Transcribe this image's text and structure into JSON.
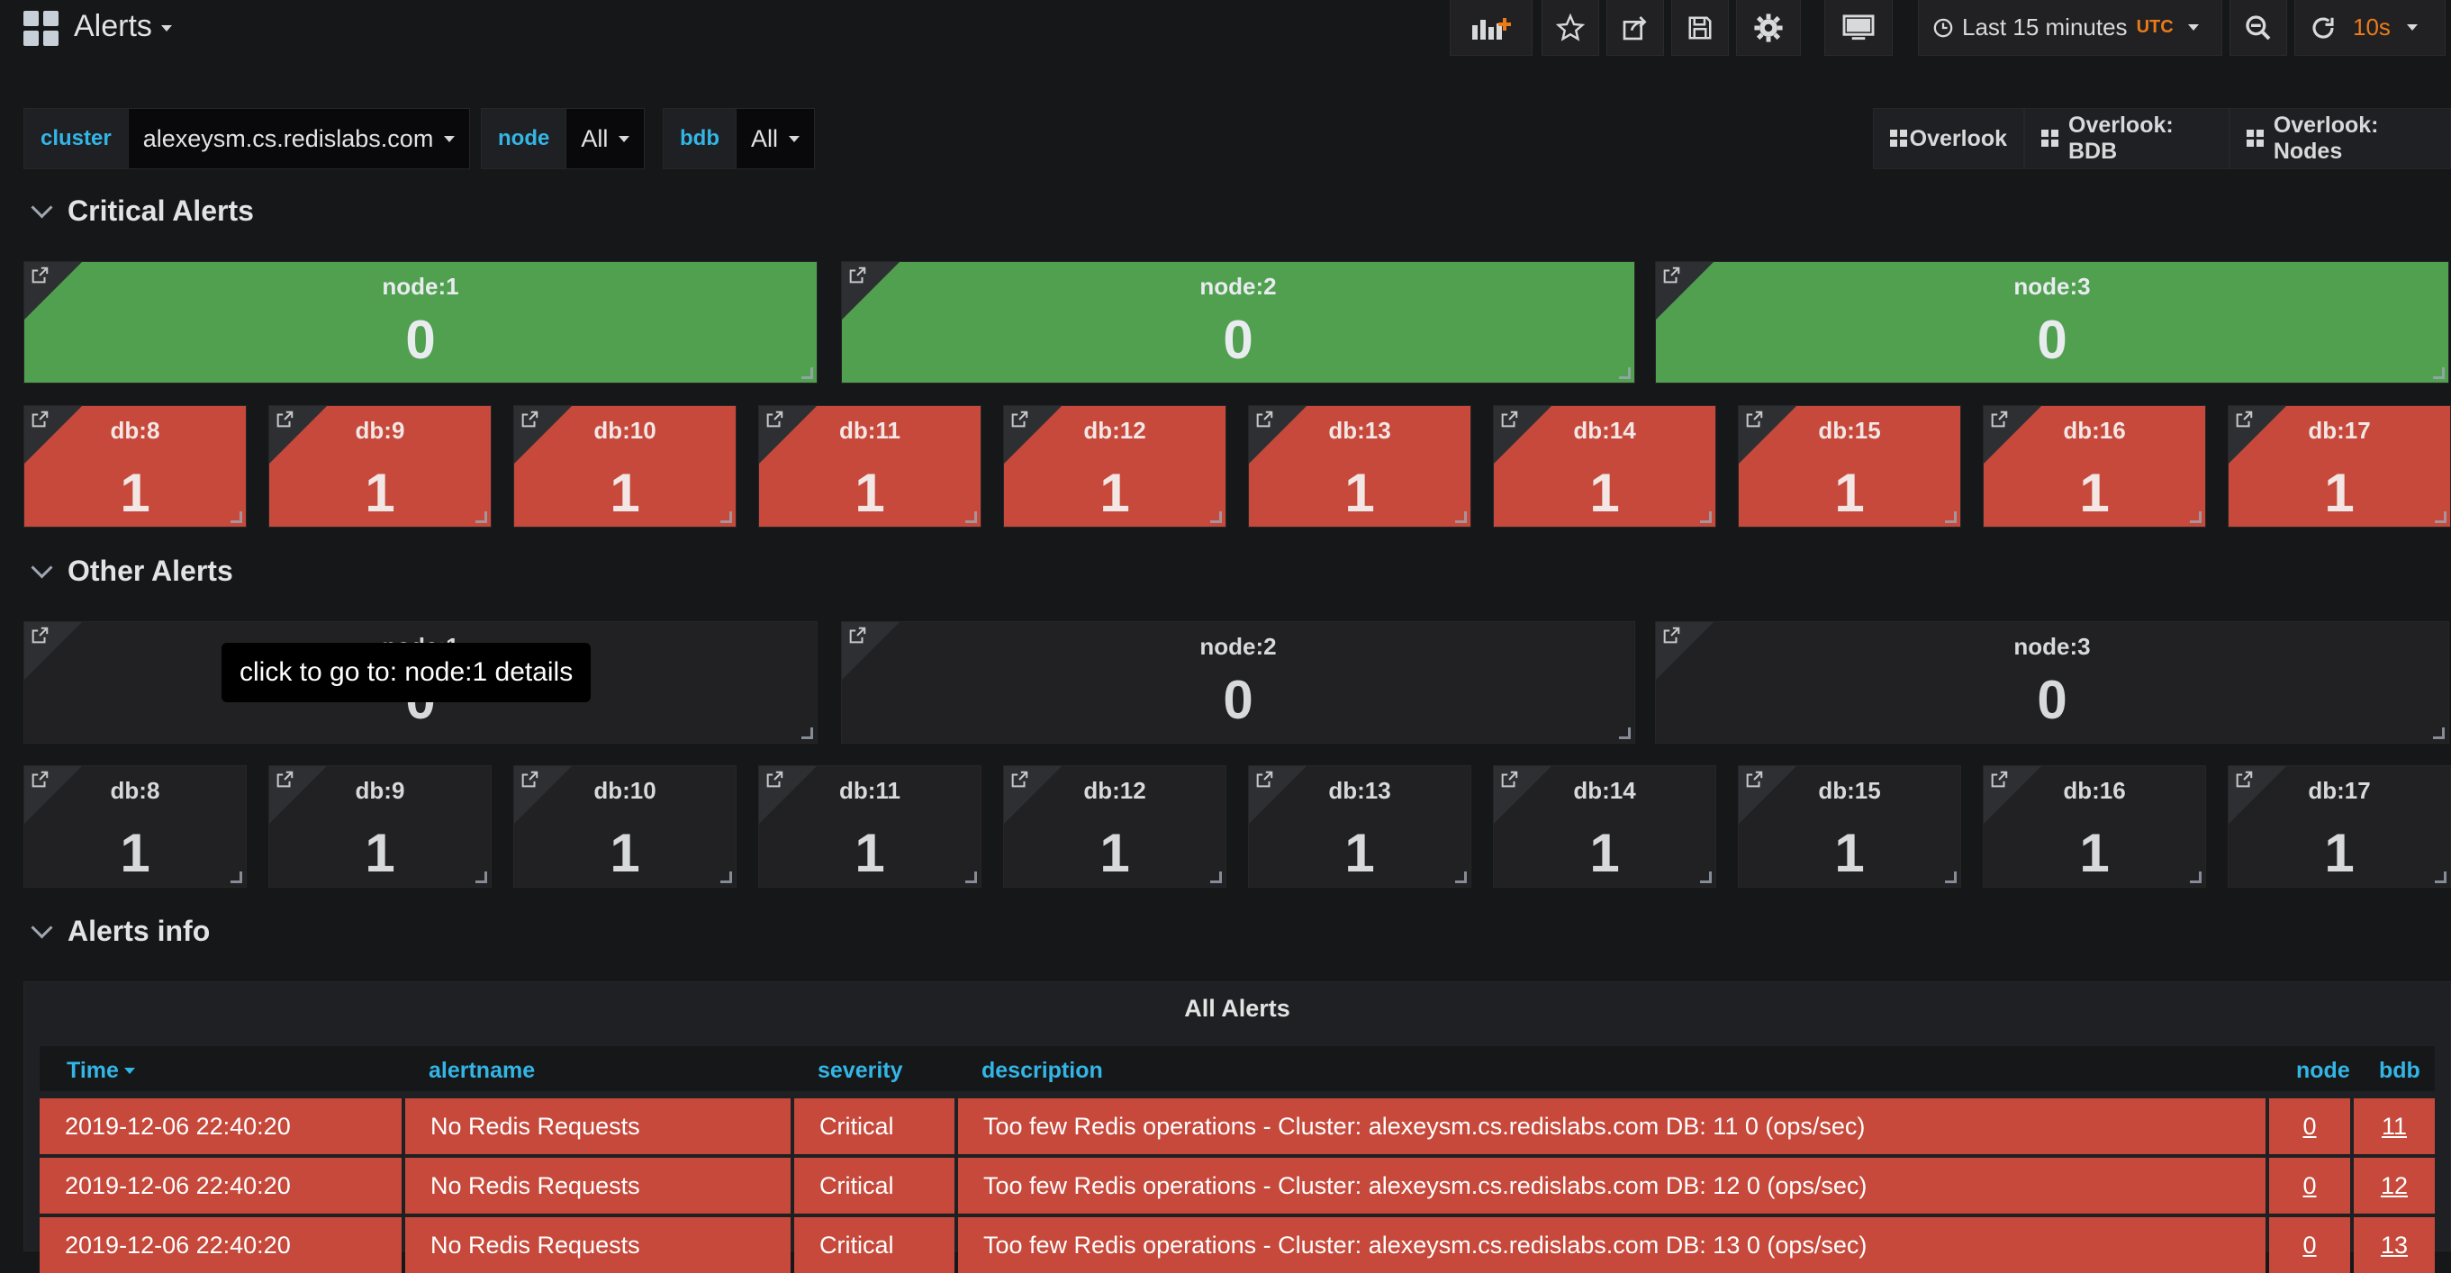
{
  "header": {
    "title": "Alerts",
    "time_range": "Last 15 minutes",
    "timezone": "UTC",
    "refresh_interval": "10s"
  },
  "variables": [
    {
      "label": "cluster",
      "value": "alexeysm.cs.redislabs.com"
    },
    {
      "label": "node",
      "value": "All"
    },
    {
      "label": "bdb",
      "value": "All"
    }
  ],
  "links": [
    "Overlook",
    "Overlook: BDB",
    "Overlook: Nodes"
  ],
  "rows": {
    "critical": "Critical Alerts",
    "other": "Other Alerts",
    "info": "Alerts info"
  },
  "critical_nodes": [
    {
      "title": "node:1",
      "value": "0"
    },
    {
      "title": "node:2",
      "value": "0"
    },
    {
      "title": "node:3",
      "value": "0"
    }
  ],
  "critical_dbs": [
    {
      "title": "db:8",
      "value": "1"
    },
    {
      "title": "db:9",
      "value": "1"
    },
    {
      "title": "db:10",
      "value": "1"
    },
    {
      "title": "db:11",
      "value": "1"
    },
    {
      "title": "db:12",
      "value": "1"
    },
    {
      "title": "db:13",
      "value": "1"
    },
    {
      "title": "db:14",
      "value": "1"
    },
    {
      "title": "db:15",
      "value": "1"
    },
    {
      "title": "db:16",
      "value": "1"
    },
    {
      "title": "db:17",
      "value": "1"
    }
  ],
  "other_nodes": [
    {
      "title": "node:1",
      "value": "0"
    },
    {
      "title": "node:2",
      "value": "0"
    },
    {
      "title": "node:3",
      "value": "0"
    }
  ],
  "other_dbs": [
    {
      "title": "db:8",
      "value": "1"
    },
    {
      "title": "db:9",
      "value": "1"
    },
    {
      "title": "db:10",
      "value": "1"
    },
    {
      "title": "db:11",
      "value": "1"
    },
    {
      "title": "db:12",
      "value": "1"
    },
    {
      "title": "db:13",
      "value": "1"
    },
    {
      "title": "db:14",
      "value": "1"
    },
    {
      "title": "db:15",
      "value": "1"
    },
    {
      "title": "db:16",
      "value": "1"
    },
    {
      "title": "db:17",
      "value": "1"
    }
  ],
  "tooltip": "click to go to: node:1 details",
  "table": {
    "title": "All Alerts",
    "columns": [
      "Time",
      "alertname",
      "severity",
      "description",
      "node",
      "bdb"
    ],
    "rows": [
      [
        "2019-12-06 22:40:20",
        "No Redis Requests",
        "Critical",
        "Too few Redis operations - Cluster: alexeysm.cs.redislabs.com DB: 11 0 (ops/sec)",
        "0",
        "11"
      ],
      [
        "2019-12-06 22:40:20",
        "No Redis Requests",
        "Critical",
        "Too few Redis operations - Cluster: alexeysm.cs.redislabs.com DB: 12 0 (ops/sec)",
        "0",
        "12"
      ],
      [
        "2019-12-06 22:40:20",
        "No Redis Requests",
        "Critical",
        "Too few Redis operations - Cluster: alexeysm.cs.redislabs.com DB: 13 0 (ops/sec)",
        "0",
        "13"
      ]
    ]
  },
  "colors": {
    "ok": "#50a050",
    "critical": "#c6493b",
    "accent": "#33b5e5",
    "orange": "#eb7b18"
  }
}
